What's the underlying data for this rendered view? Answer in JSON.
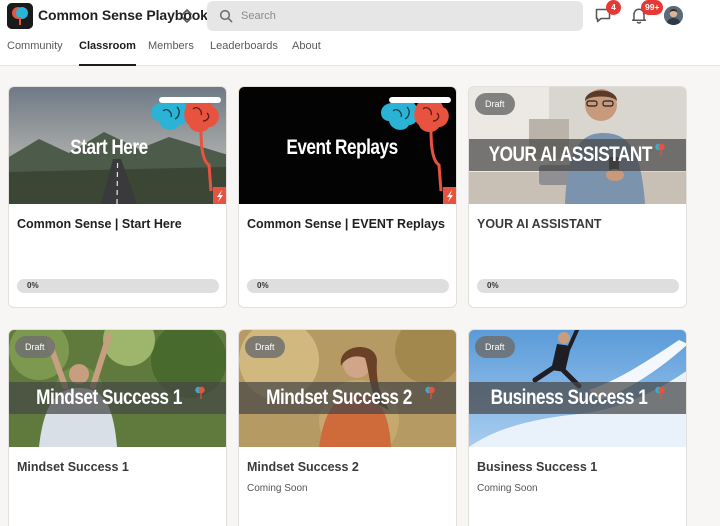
{
  "app": {
    "name": "Common Sense Playbook"
  },
  "search": {
    "placeholder": "Search"
  },
  "header": {
    "chat_badge": "4",
    "notification_badge": "99+",
    "icons": [
      "switcher-chevrons-icon",
      "search-icon",
      "chat-icon",
      "bell-icon",
      "avatar"
    ]
  },
  "nav": {
    "tabs": [
      {
        "label": "Community",
        "active": false
      },
      {
        "label": "Classroom",
        "active": true
      },
      {
        "label": "Members",
        "active": false
      },
      {
        "label": "Leaderboards",
        "active": false
      },
      {
        "label": "About",
        "active": false
      }
    ]
  },
  "courses": [
    {
      "title": "Common Sense | Start Here",
      "banner": "Start Here",
      "draft": false,
      "progress_label": "0%",
      "progress": 0,
      "subtitle": ""
    },
    {
      "title": "Common Sense | EVENT Replays",
      "banner": "Event Replays",
      "draft": false,
      "progress_label": "0%",
      "progress": 0,
      "subtitle": ""
    },
    {
      "title": "YOUR AI ASSISTANT",
      "banner": "YOUR AI ASSISTANT",
      "draft": true,
      "draft_label": "Draft",
      "progress_label": "0%",
      "progress": 0,
      "subtitle": ""
    },
    {
      "title": "Mindset Success 1",
      "banner": "Mindset Success 1",
      "draft": true,
      "draft_label": "Draft",
      "subtitle": ""
    },
    {
      "title": "Mindset Success 2",
      "banner": "Mindset Success 2",
      "draft": true,
      "draft_label": "Draft",
      "subtitle": "Coming Soon"
    },
    {
      "title": "Business Success 1",
      "banner": "Business Success 1",
      "draft": true,
      "draft_label": "Draft",
      "subtitle": "Coming Soon"
    }
  ],
  "colors": {
    "accent": "#1b1b1b",
    "badge": "#e53935",
    "brain_blue": "#2bb3d6",
    "brain_red": "#e8533f"
  }
}
